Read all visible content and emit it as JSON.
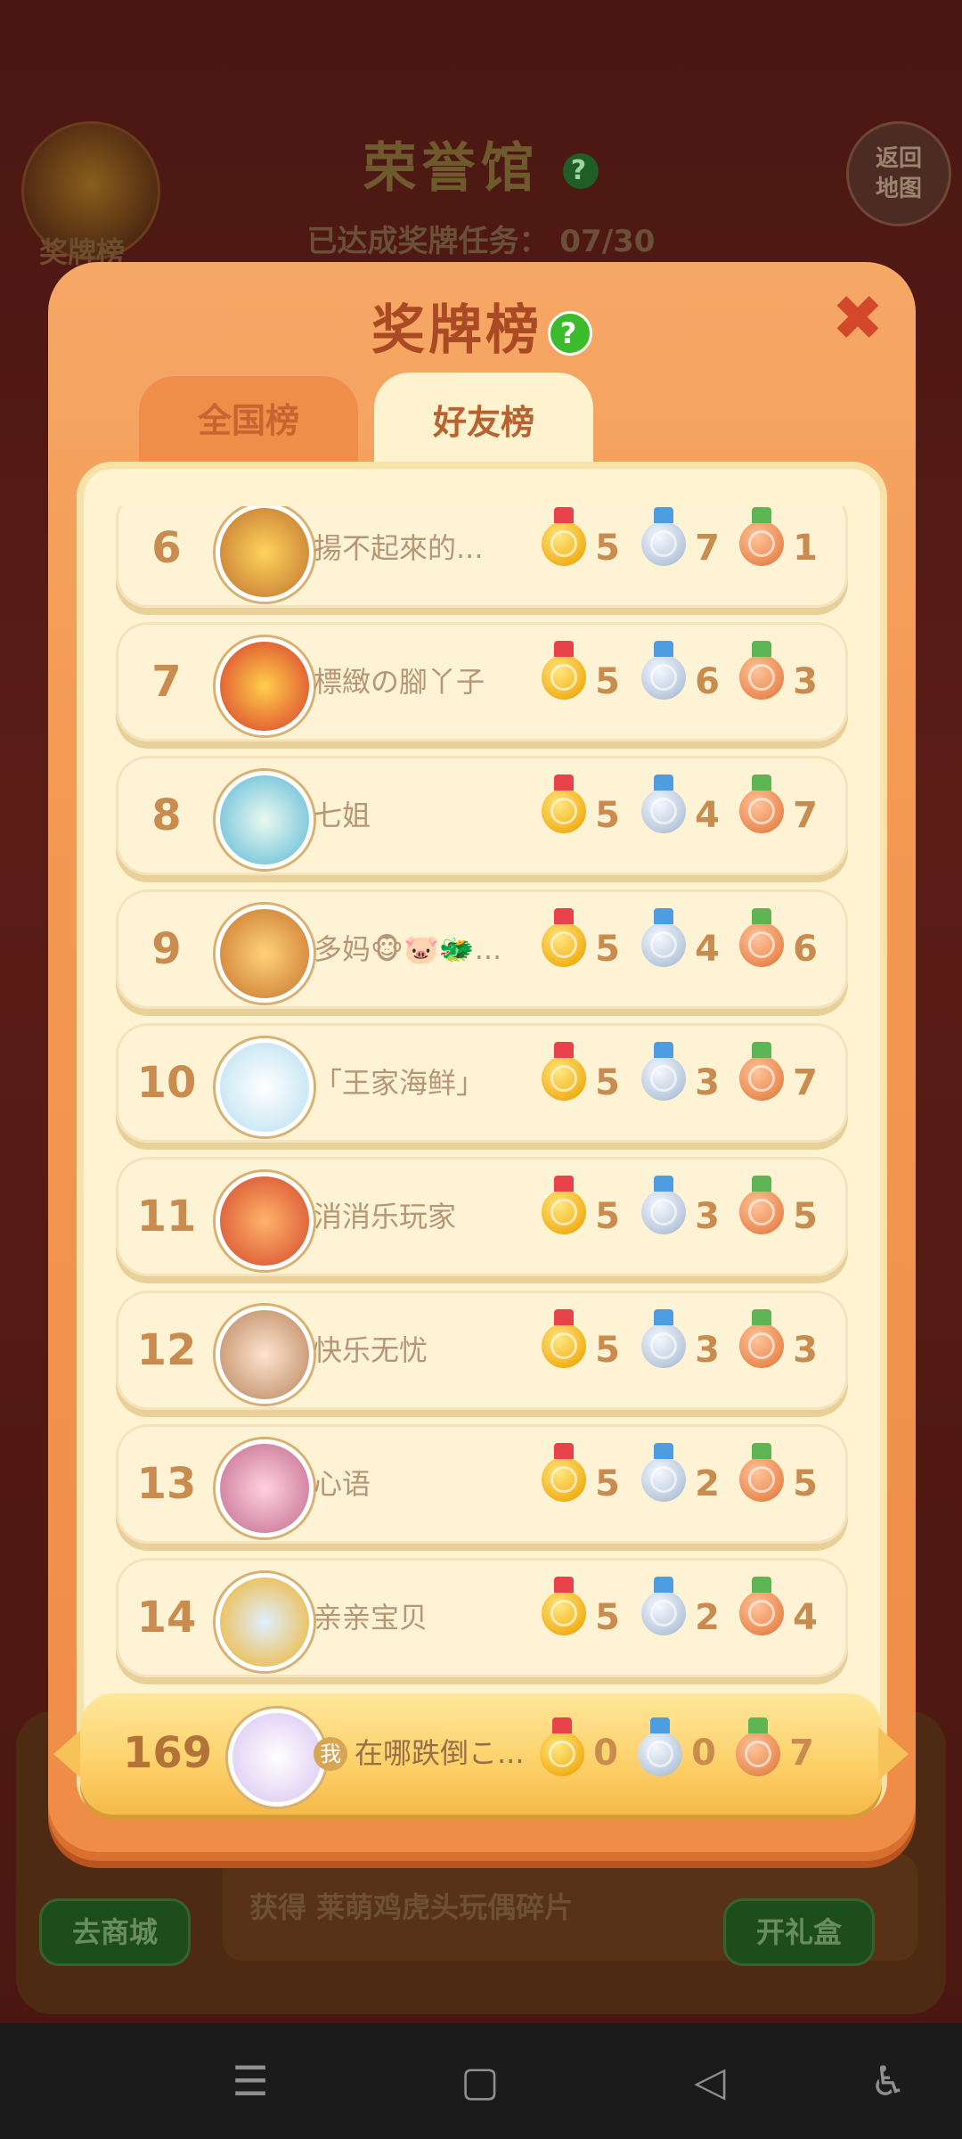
{
  "background": {
    "title": "荣誉馆",
    "subtitle": "已达成奖牌任务：",
    "progress": "07/30",
    "medal_label": "奖牌榜",
    "back_label_line1": "返回",
    "back_label_line2": "地图",
    "reward_text": "获得 莱萌鸡虎头玩偶碎片",
    "shop_button": "去商城",
    "gift_button": "开礼盒"
  },
  "modal": {
    "title": "奖牌榜",
    "help": "?",
    "close": "✖",
    "tabs": [
      {
        "label": "全国榜",
        "active": false
      },
      {
        "label": "好友榜",
        "active": true
      }
    ]
  },
  "leaderboard": [
    {
      "rank": "6",
      "name": "揚不起來的...",
      "gold": "5",
      "silver": "7",
      "bronze": "1"
    },
    {
      "rank": "7",
      "name": "標緻の腳丫子",
      "gold": "5",
      "silver": "6",
      "bronze": "3"
    },
    {
      "rank": "8",
      "name": "七姐",
      "gold": "5",
      "silver": "4",
      "bronze": "7"
    },
    {
      "rank": "9",
      "name": "多妈🐵🐷🐲...",
      "gold": "5",
      "silver": "4",
      "bronze": "6"
    },
    {
      "rank": "10",
      "name": "「王家海鲜」",
      "gold": "5",
      "silver": "3",
      "bronze": "7"
    },
    {
      "rank": "11",
      "name": "消消乐玩家",
      "gold": "5",
      "silver": "3",
      "bronze": "5"
    },
    {
      "rank": "12",
      "name": "快乐无忧",
      "gold": "5",
      "silver": "3",
      "bronze": "3"
    },
    {
      "rank": "13",
      "name": "心语",
      "gold": "5",
      "silver": "2",
      "bronze": "5"
    },
    {
      "rank": "14",
      "name": "亲亲宝贝",
      "gold": "5",
      "silver": "2",
      "bronze": "4"
    }
  ],
  "me": {
    "rank": "169",
    "tag": "我",
    "name": "在哪跌倒こ...",
    "gold": "0",
    "silver": "0",
    "bronze": "7"
  },
  "navbar": {
    "menu": "☰",
    "home": "▢",
    "back": "◁",
    "accessibility": "♿"
  }
}
